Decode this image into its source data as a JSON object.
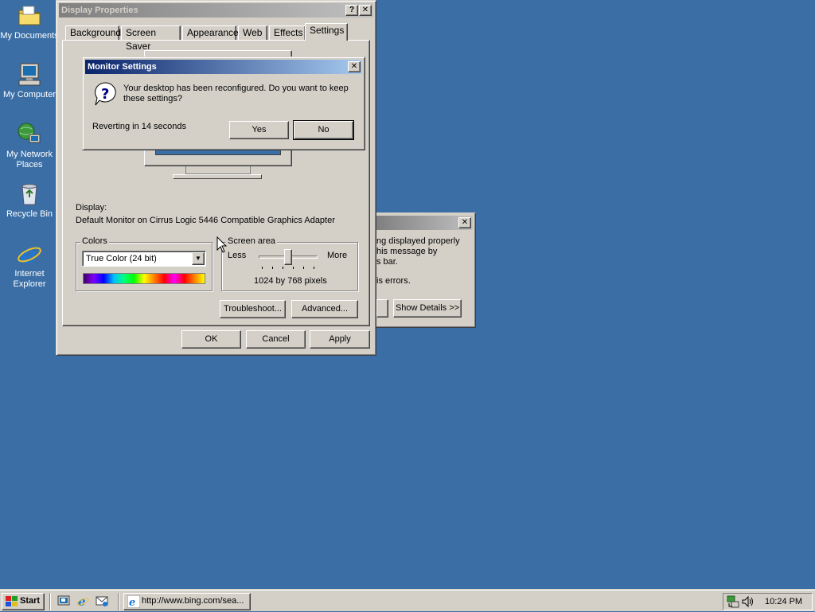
{
  "desktop": {
    "icons": [
      {
        "label": "My Documents"
      },
      {
        "label": "My Computer"
      },
      {
        "label": "My Network Places"
      },
      {
        "label": "Recycle Bin"
      },
      {
        "label": "Internet Explorer"
      }
    ]
  },
  "display_properties": {
    "title": "Display Properties",
    "help_btn": "?",
    "close_btn": "✕",
    "tabs": [
      "Background",
      "Screen Saver",
      "Appearance",
      "Web",
      "Effects",
      "Settings"
    ],
    "display_label": "Display:",
    "display_value": "Default Monitor on Cirrus Logic 5446 Compatible Graphics Adapter",
    "colors_group": "Colors",
    "colors_value": "True Color (24 bit)",
    "screen_area_group": "Screen area",
    "less": "Less",
    "more": "More",
    "resolution": "1024 by 768 pixels",
    "slider_level": 0.5,
    "troubleshoot": "Troubleshoot...",
    "advanced": "Advanced...",
    "ok": "OK",
    "cancel": "Cancel",
    "apply": "Apply"
  },
  "background_dialog": {
    "close_btn": "✕",
    "line1": "ng displayed properly",
    "line2": "his message by",
    "line3": "s bar.",
    "line4": "is errors.",
    "show_details": "Show Details >>"
  },
  "monitor_settings": {
    "title": "Monitor Settings",
    "close_btn": "✕",
    "question": "Your desktop has been reconfigured.  Do you want to keep these settings?",
    "reverting": "Reverting in 14 seconds",
    "yes": "Yes",
    "no": "No"
  },
  "taskbar": {
    "start": "Start",
    "task_label": "http://www.bing.com/sea...",
    "clock": "10:24 PM"
  },
  "colors": {
    "desktop": "#3a6ea5",
    "title_active": "#0a246a",
    "face": "#d4d0c8"
  }
}
